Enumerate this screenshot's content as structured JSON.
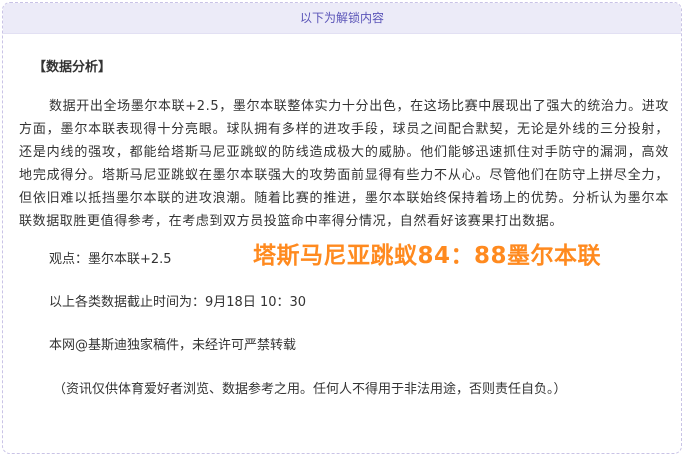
{
  "unlock_banner": {
    "label": "以下为解锁内容"
  },
  "article": {
    "section_title": "【数据分析】",
    "analysis_paragraph": "数据开出全场墨尔本联+2.5，墨尔本联整体实力十分出色，在这场比赛中展现出了强大的统治力。进攻方面，墨尔本联表现得十分亮眼。球队拥有多样的进攻手段，球员之间配合默契，无论是外线的三分投射，还是内线的强攻，都能给塔斯马尼亚跳蚁的防线造成极大的威胁。他们能够迅速抓住对手防守的漏洞，高效地完成得分。塔斯马尼亚跳蚁在墨尔本联强大的攻势面前显得有些力不从心。尽管他们在防守上拼尽全力，但依旧难以抵挡墨尔本联的进攻浪潮。随着比赛的推进，墨尔本联始终保持着场上的优势。分析认为墨尔本联数据取胜更值得参考，在考虑到双方员投篮命中率得分情况，自然看好该赛果打出数据。",
    "view_line": "观点：墨尔本联+2.5",
    "score_prediction": "塔斯马尼亚跳蚁84：88墨尔本联",
    "time_line": "以上各类数据截止时间为：9月18日 10：30",
    "copyright_line": "本网@基斯迪独家稿件，未经许可严禁转载",
    "disclaimer_line": "（资讯仅供体育爱好者浏览、数据参考之用。任何人不得用于非法用途，否则责任自负。）"
  },
  "colors": {
    "banner_background": "#ecebf8",
    "banner_text": "#5b55b8",
    "border_dashed": "#c9c3e6",
    "score_accent": "#ff8a1f",
    "body_text": "#333333"
  }
}
